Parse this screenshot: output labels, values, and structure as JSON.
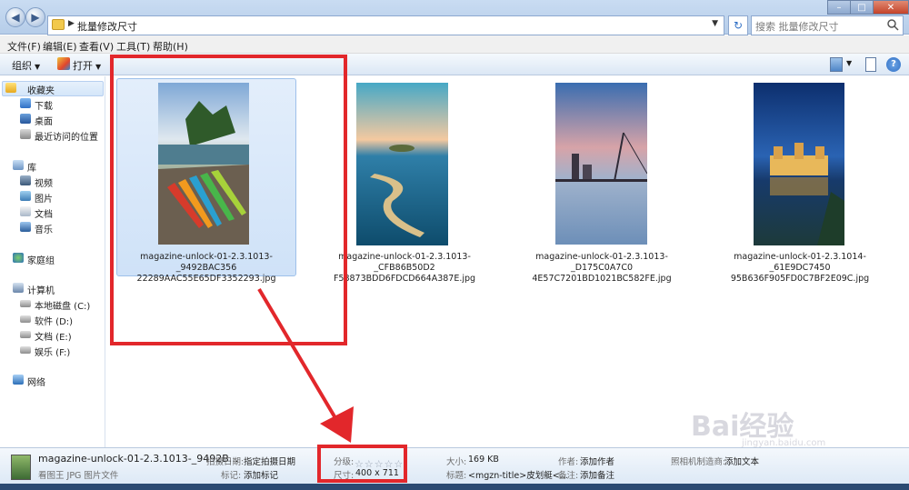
{
  "window": {
    "breadcrumb": "批量修改尺寸",
    "search_placeholder": "搜索 批量修改尺寸"
  },
  "menu": [
    "文件(F)",
    "编辑(E)",
    "查看(V)",
    "工具(T)",
    "帮助(H)"
  ],
  "toolbar": {
    "organize": "组织",
    "open": "打开"
  },
  "nav": {
    "favorites": "收藏夹",
    "downloads": "下载",
    "desktop": "桌面",
    "recent": "最近访问的位置",
    "library": "库",
    "videos": "视频",
    "pictures": "图片",
    "documents": "文档",
    "music": "音乐",
    "homegroup": "家庭组",
    "computer": "计算机",
    "drive_c": "本地磁盘 (C:)",
    "drive_d": "软件 (D:)",
    "drive_e": "文档 (E:)",
    "drive_f": "娱乐 (F:)",
    "network": "网络"
  },
  "files": [
    {
      "line1": "magazine-unlock-01-2.3.1013-_9492BAC356",
      "line2": "22289AAC55E65DF3352293.jpg",
      "selected": true
    },
    {
      "line1": "magazine-unlock-01-2.3.1013-_CFB86B50D2",
      "line2": "F58873BDD6FDCD664A387E.jpg",
      "selected": false
    },
    {
      "line1": "magazine-unlock-01-2.3.1013-_D175C0A7C0",
      "line2": "4E57C7201BD1021BC582FE.jpg",
      "selected": false
    },
    {
      "line1": "magazine-unlock-01-2.3.1014-_61E9DC7450",
      "line2": "95B636F905FD0C7BF2E09C.jpg",
      "selected": false
    }
  ],
  "details": {
    "filename": "magazine-unlock-01-2.3.1013-_9492B...",
    "filetype": "看图王 JPG 图片文件",
    "date_taken_label": "拍摄日期:",
    "date_taken_value": "指定拍摄日期",
    "tags_label": "标记:",
    "tags_value": "添加标记",
    "rating_label": "分级:",
    "dimensions_label": "尺寸:",
    "dimensions_value": "400 x 711",
    "size_label": "大小:",
    "size_value": "169 KB",
    "title_label": "标题:",
    "title_value": "<mgzn-title>皮划艇<...",
    "author_label": "作者:",
    "author_value": "添加作者",
    "comment_label": "备注:",
    "comment_value": "添加备注",
    "maker_label": "照相机制造商:",
    "maker_value": "添加文本"
  },
  "watermark": {
    "brand": "Bai经验",
    "url": "jingyan.baidu.com"
  }
}
